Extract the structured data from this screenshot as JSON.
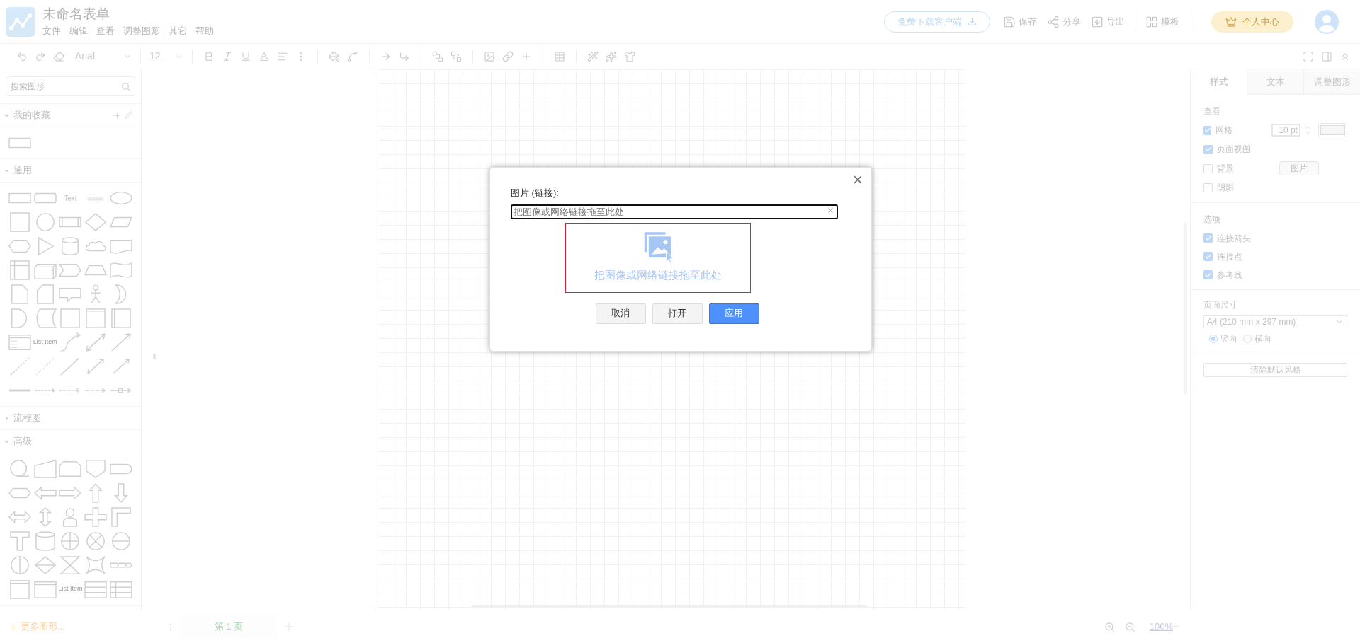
{
  "header": {
    "title": "未命名表单",
    "menu": [
      "文件",
      "编辑",
      "查看",
      "调整图形",
      "其它",
      "帮助"
    ],
    "download_button": "免费下载客户端",
    "actions": [
      "保存",
      "分享",
      "导出",
      "模板"
    ],
    "user_center": "个人中心"
  },
  "toolbar": {
    "font": "Arial",
    "font_size": "12"
  },
  "sidebar": {
    "search": {
      "placeholder": "搜索图形"
    },
    "sections": [
      {
        "title": "我的收藏",
        "expanded": true
      },
      {
        "title": "通用",
        "expanded": true,
        "labels": [
          "Text",
          "List Item"
        ]
      },
      {
        "title": "流程图",
        "expanded": false
      },
      {
        "title": "高级",
        "expanded": true,
        "labels": [
          "List Item"
        ]
      }
    ],
    "more": "更多图形..."
  },
  "pages": [
    {
      "label": "第 1 页",
      "selected": true
    }
  ],
  "zoom": "100%",
  "panel": {
    "tabs": [
      {
        "label": "样式",
        "selected": true
      },
      {
        "label": "文本",
        "selected": false
      },
      {
        "label": "调整图形",
        "selected": false
      }
    ],
    "view_title": "查看",
    "view_options": [
      {
        "label": "网格",
        "checked": true
      },
      {
        "label": "页面视图",
        "checked": true
      },
      {
        "label": "背景",
        "checked": false
      },
      {
        "label": "阴影",
        "checked": false
      }
    ],
    "grid_size": "10 pt",
    "background_button": "图片",
    "options_title": "选项",
    "options": [
      {
        "label": "连接箭头",
        "checked": true
      },
      {
        "label": "连接点",
        "checked": true
      },
      {
        "label": "参考线",
        "checked": true
      }
    ],
    "page_size_title": "页面尺寸",
    "page_size": "A4 (210 mm x 297 mm)",
    "orientation": [
      {
        "label": "竖向",
        "selected": true
      },
      {
        "label": "横向",
        "selected": false
      }
    ],
    "reset_button": "清除默认风格"
  },
  "dialog": {
    "label": "图片 (链接):",
    "input": {
      "placeholder": "把图像或网络链接拖至此处"
    },
    "drop_text": "把图像或网络链接拖至此处",
    "buttons": [
      {
        "label": "取消",
        "kind": "default"
      },
      {
        "label": "打开",
        "kind": "default"
      },
      {
        "label": "应用",
        "kind": "primary"
      }
    ]
  }
}
